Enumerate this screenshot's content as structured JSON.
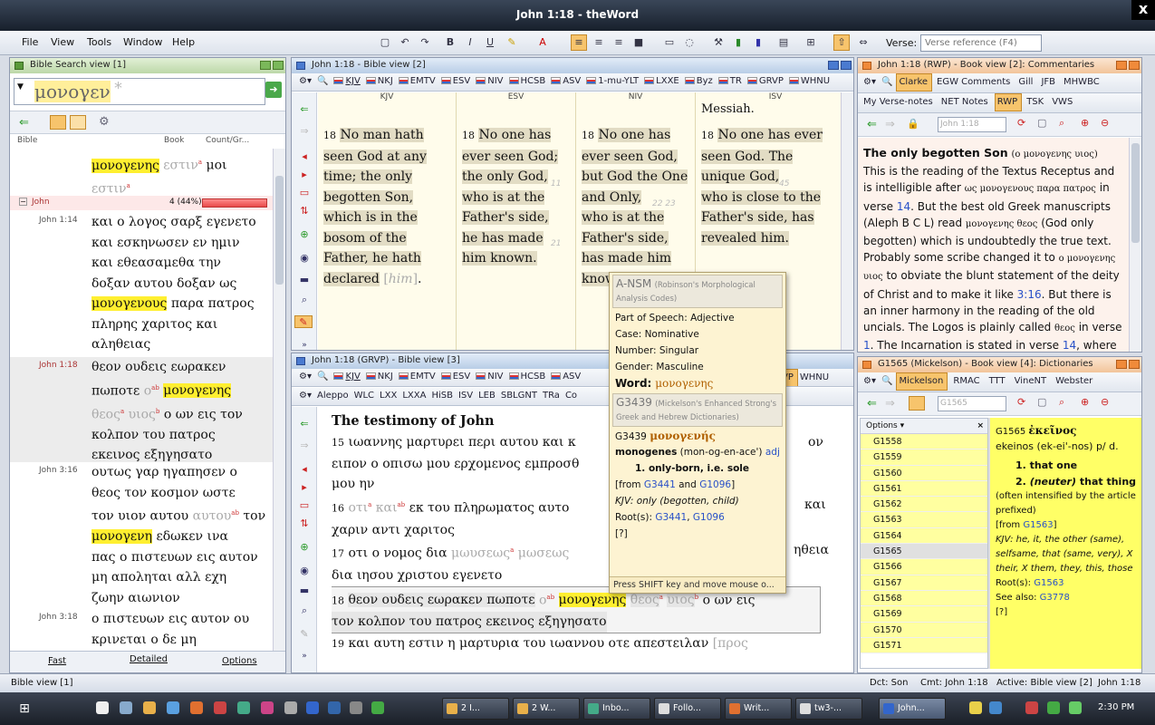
{
  "window": {
    "title": "John 1:18 - theWord",
    "close": "x"
  },
  "menu": [
    "File",
    "View",
    "Tools",
    "Window",
    "Help"
  ],
  "verse": {
    "label": "Verse:",
    "placeholder": "Verse reference (F4)"
  },
  "search": {
    "header": "Bible Search view [1]",
    "query": "μονογεν",
    "query_suffix": "*",
    "cols": [
      "Bible",
      "Book",
      "Count/Gr..."
    ],
    "book_row": {
      "name": "John",
      "count": "4 (44%)"
    },
    "top_text": [
      "μονογενης",
      "εστιν",
      "μοι",
      "εστιν"
    ],
    "results": [
      {
        "ref": "John 1:14",
        "lines": [
          "και ο λογος σαρξ εγενετο",
          "και εσκηνωσεν εν ημιν",
          "και εθεασαμεθα την",
          "δοξαν αυτου δοξαν ως"
        ],
        "hl_line": "μονογενους",
        "hl_rest": "παρα πατρος",
        "tail": [
          "πληρης χαριτος και",
          "αληθειας"
        ]
      },
      {
        "ref": "John 1:18",
        "line1": "θεον ουδεις εωρακεν",
        "line2a": "πωποτε",
        "line2b": "μονογενης",
        "line3a": "θεος",
        "line3b": "υιος",
        "line3c": "ο ων εις τον",
        "tail": [
          "κολπον του πατρος",
          "εκεινος εξηγησατο"
        ]
      },
      {
        "ref": "John 3:16",
        "lines": [
          "ουτως γαρ ηγαπησεν ο",
          "θεος τον κοσμον ωστε",
          "τον υιον αυτου",
          "τον"
        ],
        "hl_line": "μονογενη",
        "hl_rest": "εδωκεν ινα",
        "tail": [
          "πας ο πιστευων εις αυτον",
          "μη αποληται αλλ εχη",
          "ζωην αιωνιον"
        ]
      },
      {
        "ref": "John 3:18",
        "lines": [
          "ο πιστευων εις αυτον ου",
          "κρινεται ο δε μη"
        ]
      }
    ],
    "bottom_tabs": [
      "Fast",
      "Detailed",
      "Options"
    ]
  },
  "bible_top": {
    "header": "John 1:18 - Bible view [2]",
    "tabs": [
      "KJV",
      "NKJ",
      "EMTV",
      "ESV",
      "NIV",
      "HCSB",
      "ASV",
      "1-mu-YLT",
      "LXXE",
      "Byz",
      "TR",
      "GRVP",
      "WHNU"
    ],
    "columns": [
      {
        "name": "KJV",
        "num": "18",
        "text": "No man hath seen God at any time; the only begotten Son, which is in the bosom of the Father, he hath declared",
        "bracket": "him"
      },
      {
        "name": "ESV",
        "num": "18",
        "l1": "No one has ever seen God;",
        "l2": "the only God,",
        "l3": "who is at the Father's side,",
        "l4": "he has made him known.",
        "s1": "11",
        "s2": "21"
      },
      {
        "name": "NIV",
        "num": "18",
        "l1": "No one has ever seen God, but God the One and Only,",
        "l2": "who is at the Father's side,",
        "l3": "has made him known.",
        "s1": "22 23"
      },
      {
        "name": "ISV",
        "top": "Messiah.",
        "num": "18",
        "l1": "No one has ever seen God. The",
        "l2": "unique God,",
        "l3": "who is close to the Father's side, has revealed him.",
        "s1": "45"
      }
    ]
  },
  "popup": {
    "title": "A-NSM",
    "title_sub": "(Robinson's Morphological Analysis Codes)",
    "fields": [
      "Part of Speech: Adjective",
      "Case: Nominative",
      "Number: Singular",
      "Gender: Masculine"
    ],
    "word_label": "Word:",
    "word": "μονογενης",
    "strong_title": "G3439",
    "strong_sub": "(Mickelson's Enhanced Strong's Greek and Hebrew Dictionaries)",
    "strong_code": "G3439",
    "strong_greek": "μονογενής",
    "translit": "monogenes",
    "pron": "(mon-og-en-ace')",
    "pos": "adj",
    "def": "1. only-born, i.e. sole",
    "from_label": "[from",
    "from1": "G3441",
    "from_and": "and",
    "from2": "G1096",
    "from_end": "]",
    "kjv": "KJV: only (begotten, child)",
    "roots_label": "Root(s):",
    "root1": "G3441",
    "root2": "G1096",
    "foot_mark": "[?]",
    "footer": "Press SHIFT key and move mouse o..."
  },
  "bible_bottom": {
    "header": "John 1:18 (GRVP) - Bible view [3]",
    "tabs1": [
      "KJV",
      "NKJ",
      "EMTV",
      "ESV",
      "NIV",
      "HCSB",
      "ASV"
    ],
    "tabs1_end": [
      "VP",
      "WHNU"
    ],
    "tabs2": [
      "Aleppo",
      "WLC",
      "LXX",
      "LXXA",
      "HiSB",
      "ISV",
      "LEB",
      "SBLGNT",
      "TRa",
      "Co"
    ],
    "heading": "The testimony of John",
    "v15a": "ιωαννης μαρτυρει περι αυτου και κ",
    "v15a_end": "ον",
    "v15b": "ειπον ο οπισω μου ερχομενος εμπροσθ",
    "v15c": "μου ην",
    "v16a": "οτι",
    "v16b": "και",
    "v16c": "εκ του πληρωματος αυτο",
    "v16end": "και",
    "v16d": "χαριν αντι χαριτος",
    "v17a": "οτι ο νομος δια",
    "v17b": "μωυσεως",
    "v17c": "μωσεως",
    "v17end": "ηθεια",
    "v17d": "δια ιησου χριστου εγενετο",
    "v18a": "θεον ουδεις εωρακεν πωποτε",
    "v18b": "ο",
    "v18hl": "μονογενης",
    "v18c": "θεος",
    "v18d": "υιος",
    "v18e": "ο ων εις",
    "v18f": "τον κολπον του πατρος εκεινος εξηγησατο",
    "v19": "και αυτη εστιν η μαρτυρια του ιωαννου οτε απεστειλαν",
    "v19b": "[προς",
    "n15": "15",
    "n16": "16",
    "n17": "17",
    "n18": "18",
    "n19": "19"
  },
  "commentary": {
    "header": "John 1:18 (RWP) - Book view [2]: Commentaries",
    "tabs1": [
      "Clarke",
      "EGW Comments",
      "Gill",
      "JFB",
      "MHWBC"
    ],
    "tabs2": [
      "My Verse-notes",
      "NET Notes",
      "RWP",
      "TSK",
      "VWS"
    ],
    "verse_box": "John 1:18",
    "title": "The only begotten Son",
    "title_greek": "(ο μονογενης υιος)",
    "p1": "This is the reading of the Textus Receptus and is intelligible after",
    "g1": "ως μονογενους παρα πατρος",
    "p1b": "in verse",
    "l1": "14",
    "p1c": ". But the best old Greek manuscripts (Aleph B C L) read",
    "g2": "μονογενης θεος",
    "p2": "(God only begotten) which is undoubtedly the true text. Probably some scribe changed it to",
    "g3": "ο μονογενης υιος",
    "p3": "to obviate the blunt statement of the deity of Christ and to make it like",
    "l2": "3:16",
    "p4": ". But there is an inner harmony in the reading of the old uncials. The Logos is plainly called",
    "g4": "θεος",
    "p5": "in verse",
    "l3": "1",
    "p6": ". The Incarnation is stated in verse",
    "l4": "14",
    "p7": ", where he is"
  },
  "dict": {
    "header": "G1565 (Mickelson) - Book view [4]: Dictionaries",
    "tabs": [
      "Mickelson",
      "RMAC",
      "TTT",
      "VineNT",
      "Webster"
    ],
    "search": "G1565",
    "options": "Options",
    "list": [
      "G1558",
      "G1559",
      "G1560",
      "G1561",
      "G1562",
      "G1563",
      "G1564",
      "G1565",
      "G1566",
      "G1567",
      "G1568",
      "G1569",
      "G1570",
      "G1571"
    ],
    "selected": "G1565",
    "entry_code": "G1565",
    "entry_greek": "ἐκεῖνος",
    "entry_trans": "ekeinos",
    "entry_pron": "(ek-ei'-nos) p/ d.",
    "d1": "1. that one",
    "d2a": "2.",
    "d2b": "(neuter)",
    "d2c": "that thing",
    "d3": "(often intensified by the article prefixed)",
    "d4a": "[from",
    "d4b": "G1563",
    "d4c": "]",
    "d5": "KJV: he, it, the other (same), selfsame, that (same, very), X their, X them, they, this, those",
    "d6a": "Root(s):",
    "d6b": "G1563",
    "d7a": "See also:",
    "d7b": "G3778",
    "d8": "[?]"
  },
  "status": {
    "left": "Bible view [1]",
    "dct": "Dct: Son",
    "cmt": "Cmt: John 1:18",
    "active": "Active: Bible view [2]",
    "ref": "John 1:18"
  },
  "taskbar": {
    "items": [
      "2 I...",
      "2 W...",
      "Inbo...",
      "Follo...",
      "Writ...",
      "tw3-...",
      "John..."
    ],
    "time": "2:30 PM"
  }
}
